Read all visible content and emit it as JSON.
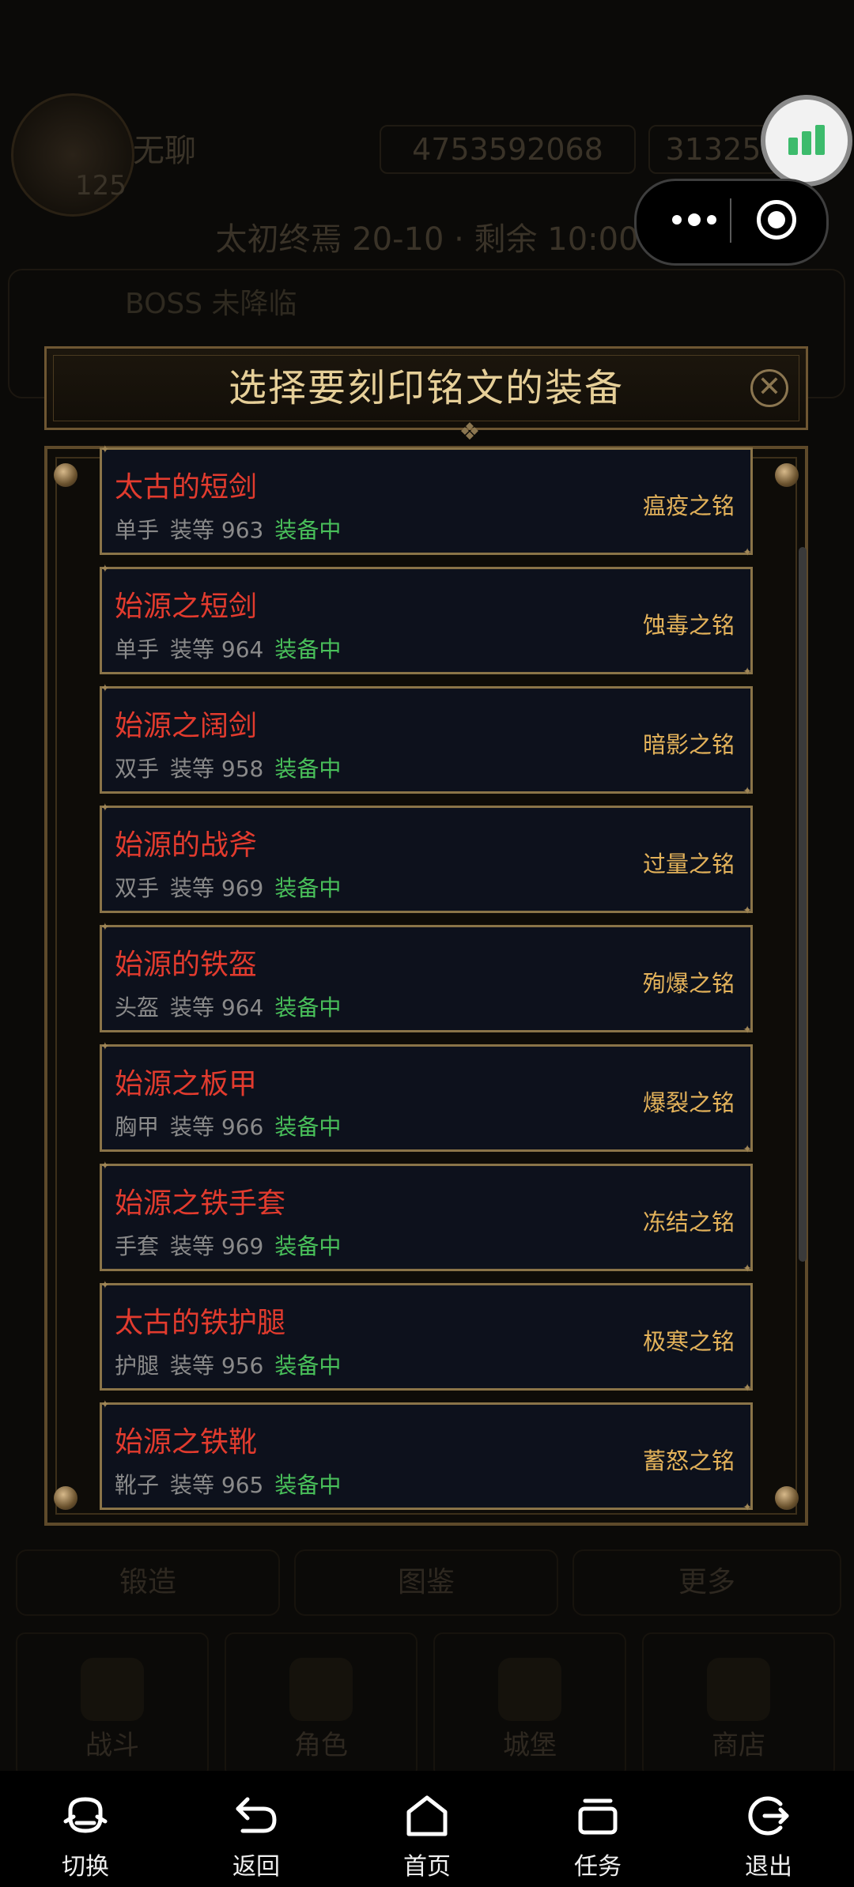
{
  "background": {
    "player_name": "无聊",
    "level": "125",
    "gold": "4753592068",
    "gems": "31325",
    "stage": "太初终焉 20-10 · 剩余 10:00",
    "boss_status": "BOSS 未降临",
    "buttons": [
      "锻造",
      "图鉴",
      "更多"
    ],
    "tabs": [
      "战斗",
      "角色",
      "城堡",
      "商店"
    ]
  },
  "modal": {
    "title": "选择要刻印铭文的装备",
    "items": [
      {
        "name": "太古的短剑",
        "slot": "单手",
        "ilvl": "装等 963",
        "status": "装备中",
        "rune": "瘟疫之铭"
      },
      {
        "name": "始源之短剑",
        "slot": "单手",
        "ilvl": "装等 964",
        "status": "装备中",
        "rune": "蚀毒之铭"
      },
      {
        "name": "始源之阔剑",
        "slot": "双手",
        "ilvl": "装等 958",
        "status": "装备中",
        "rune": "暗影之铭"
      },
      {
        "name": "始源的战斧",
        "slot": "双手",
        "ilvl": "装等 969",
        "status": "装备中",
        "rune": "过量之铭"
      },
      {
        "name": "始源的铁盔",
        "slot": "头盔",
        "ilvl": "装等 964",
        "status": "装备中",
        "rune": "殉爆之铭"
      },
      {
        "name": "始源之板甲",
        "slot": "胸甲",
        "ilvl": "装等 966",
        "status": "装备中",
        "rune": "爆裂之铭"
      },
      {
        "name": "始源之铁手套",
        "slot": "手套",
        "ilvl": "装等 969",
        "status": "装备中",
        "rune": "冻结之铭"
      },
      {
        "name": "太古的铁护腿",
        "slot": "护腿",
        "ilvl": "装等 956",
        "status": "装备中",
        "rune": "极寒之铭"
      },
      {
        "name": "始源之铁靴",
        "slot": "靴子",
        "ilvl": "装等 965",
        "status": "装备中",
        "rune": "蓄怒之铭"
      }
    ]
  },
  "bottom_nav": [
    {
      "label": "切换",
      "icon": "switch-icon"
    },
    {
      "label": "返回",
      "icon": "back-icon"
    },
    {
      "label": "首页",
      "icon": "home-icon"
    },
    {
      "label": "任务",
      "icon": "tasks-icon"
    },
    {
      "label": "退出",
      "icon": "exit-icon"
    }
  ],
  "colors": {
    "item_name": "#e23b2e",
    "equipped": "#49c05a",
    "rune": "#e3b25a",
    "title": "#e6cf98",
    "frame": "#8a7448"
  }
}
